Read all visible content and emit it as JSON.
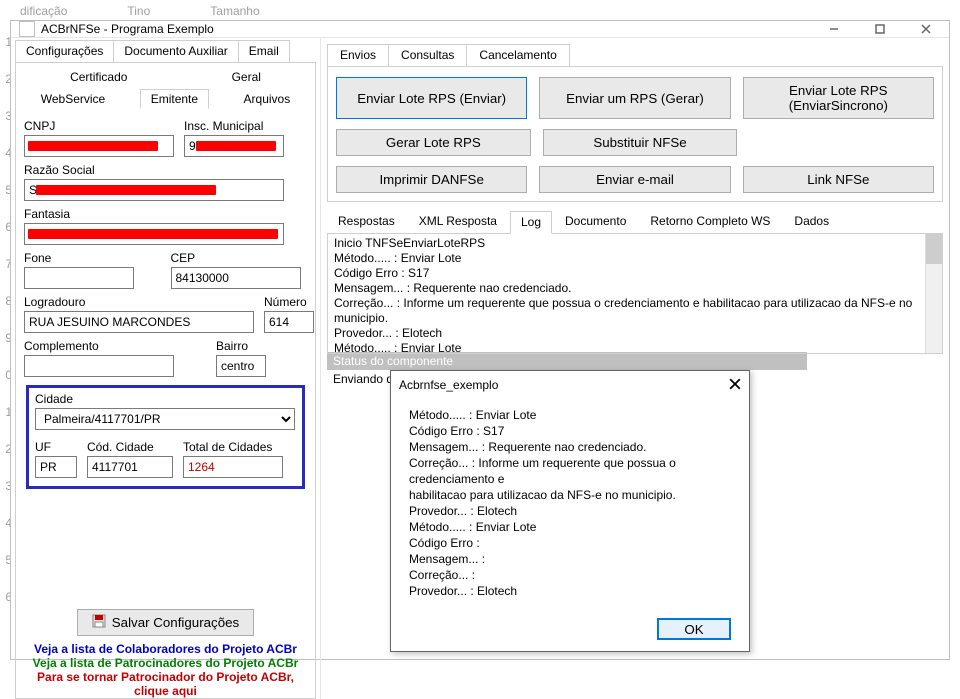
{
  "bg": {
    "cols": [
      "dificação",
      "Tino",
      "Tamanho"
    ],
    "rows": [
      "1",
      "2",
      "3",
      "4",
      "5",
      "6",
      "7",
      "8",
      "9",
      "0",
      "1",
      "2",
      "3",
      "4",
      "5",
      "6"
    ]
  },
  "window": {
    "title": "ACBrNFSe - Programa Exemplo"
  },
  "leftTabs": {
    "t1": "Configurações",
    "t2": "Documento Auxiliar",
    "t3": "Email"
  },
  "subTabs": {
    "cert": "Certificado",
    "geral": "Geral",
    "ws": "WebService",
    "emit": "Emitente",
    "arq": "Arquivos"
  },
  "form": {
    "cnpj_lbl": "CNPJ",
    "cnpj_val": "",
    "insc_lbl": "Insc. Municipal",
    "insc_val": "9",
    "razao_lbl": "Razão Social",
    "razao_val": "S",
    "fantasia_lbl": "Fantasia",
    "fantasia_val": "",
    "fone_lbl": "Fone",
    "fone_val": "",
    "cep_lbl": "CEP",
    "cep_val": "84130000",
    "logradouro_lbl": "Logradouro",
    "logradouro_val": "RUA JESUINO MARCONDES",
    "numero_lbl": "Número",
    "numero_val": "614",
    "compl_lbl": "Complemento",
    "compl_val": "",
    "bairro_lbl": "Bairro",
    "bairro_val": "centro",
    "cidade_lbl": "Cidade",
    "cidade_val": "Palmeira/4117701/PR",
    "uf_lbl": "UF",
    "uf_val": "PR",
    "cod_lbl": "Cód. Cidade",
    "cod_val": "4117701",
    "tot_lbl": "Total de Cidades",
    "tot_val": "1264"
  },
  "saveBtn": "Salvar Configurações",
  "links": {
    "colab": "Veja a lista de Colaboradores do Projeto ACBr",
    "patroc": "Veja a lista de Patrocinadores do Projeto ACBr",
    "sej1": "Para se tornar Patrocinador do Projeto ACBr,",
    "sej2": "clique aqui"
  },
  "rightTabs": {
    "env": "Envios",
    "cons": "Consultas",
    "canc": "Cancelamento"
  },
  "buttons": {
    "b1": "Enviar Lote RPS (Enviar)",
    "b2": "Enviar um RPS (Gerar)",
    "b3": "Enviar Lote RPS (EnviarSincrono)",
    "b4": "Gerar Lote RPS",
    "b5": "Substituir NFSe",
    "b6": "Imprimir DANFSe",
    "b7": "Enviar e-mail",
    "b8": "Link NFSe"
  },
  "logTabs": {
    "lt1": "Respostas",
    "lt2": "XML Resposta",
    "lt3": "Log",
    "lt4": "Documento",
    "lt5": "Retorno Completo WS",
    "lt6": "Dados"
  },
  "log": "Inicio TNFSeEnviarLoteRPS\nMétodo..... : Enviar Lote\nCódigo Erro : S17\nMensagem... : Requerente nao credenciado.\nCorreção... : Informe um requerente que possua o credenciamento e habilitacao para utilizacao da NFS-e no municipio.\nProvedor... : Elotech\nMétodo..... : Enviar Lote",
  "status": {
    "bar": "Status do componente",
    "line": "Enviando dados da NFSe..."
  },
  "modal": {
    "title": "Acbrnfse_exemplo",
    "body": "Método..... : Enviar Lote\nCódigo Erro : S17\nMensagem... : Requerente nao credenciado.\nCorreção... : Informe um requerente que possua o credenciamento e\nhabilitacao para utilizacao da NFS-e no municipio.\nProvedor... : Elotech\nMétodo..... : Enviar Lote\nCódigo Erro :\nMensagem... :\nCorreção... :\nProvedor... : Elotech",
    "ok": "OK"
  }
}
